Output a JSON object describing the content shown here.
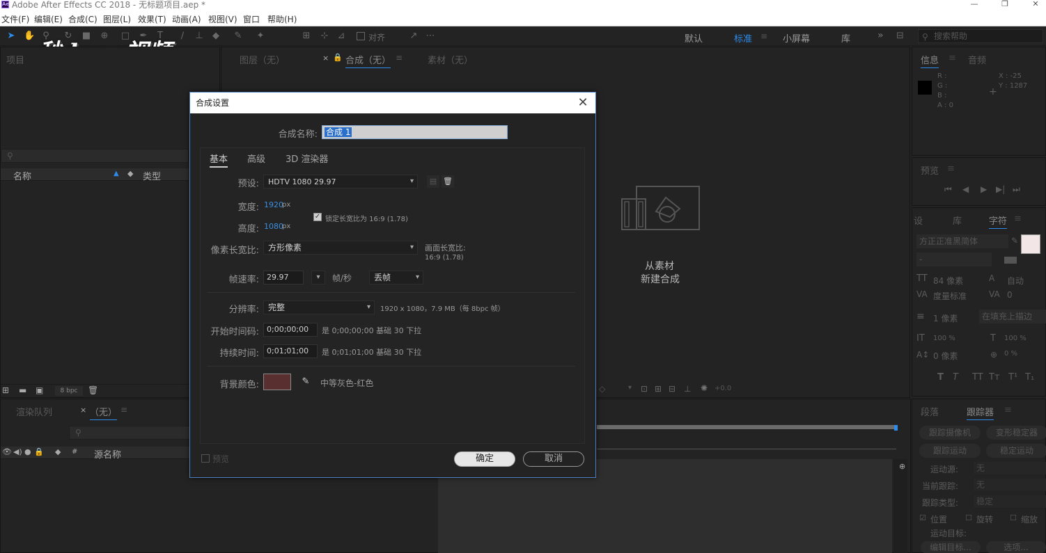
{
  "app": {
    "title": "Adobe After Effects CC 2018 - 无标题项目.aep *",
    "logo": "Ae"
  },
  "menu": [
    "文件(F)",
    "编辑(E)",
    "合成(C)",
    "图层(L)",
    "效果(T)",
    "动画(A)",
    "视图(V)",
    "窗口",
    "帮助(H)"
  ],
  "toolbar": {
    "align_label": "对齐"
  },
  "workspaces": [
    "默认",
    "标准",
    "小屏幕",
    "库"
  ],
  "help_search": {
    "placeholder": "搜索帮助"
  },
  "watermark": "秒dong视频",
  "project_panel": {
    "tab": "项目",
    "columns": {
      "name": "名称",
      "type": "类型"
    },
    "bpc": "8 bpc"
  },
  "viewer_tabs": {
    "layer": "图层（无）",
    "comp": "合成（无）",
    "footage": "素材（无）"
  },
  "viewer_empty": {
    "line1": "从素材",
    "line2": "新建合成"
  },
  "render_panel": {
    "tab1": "渲染队列",
    "tab2": "（无）",
    "source_name": "源名称"
  },
  "info_panel": {
    "tab1": "信息",
    "tab2": "音频",
    "r": "R :",
    "g": "G :",
    "b": "B :",
    "a": "A : 0",
    "x": "X : -25",
    "y": "Y : 1287"
  },
  "preview_panel": {
    "tab": "预览"
  },
  "char_panel": {
    "tabs": [
      "设",
      "库",
      "字符"
    ],
    "font": "方正正准黑简体",
    "style": "-",
    "size": "84 像素",
    "leading": "自动",
    "kerning": "度量标准",
    "tracking": "0",
    "stroke": "1 像素",
    "stroke_mode": "在填充上描边",
    "vscale": "100 %",
    "hscale": "100 %",
    "baseline": "0 像素",
    "tsume": "0 %"
  },
  "tracker_panel": {
    "tabs": [
      "段落",
      "跟踪器"
    ],
    "btn_camera": "跟踪摄像机",
    "btn_warp": "变形稳定器",
    "btn_motion": "跟踪运动",
    "btn_stab": "稳定运动",
    "source_label": "运动源:",
    "source_val": "无",
    "current_label": "当前跟踪:",
    "current_val": "无",
    "type_label": "跟踪类型:",
    "type_val": "稳定",
    "pos": "位置",
    "rot": "旋转",
    "scale": "缩放",
    "target_label": "运动目标:",
    "edit_target": "编辑目标...",
    "options": "选项..."
  },
  "comp_controls": {
    "offset": "+0.0"
  },
  "dialog": {
    "title": "合成设置",
    "name_label": "合成名称:",
    "name_value": "合成 1",
    "tabs": [
      "基本",
      "高级",
      "3D 渲染器"
    ],
    "preset_label": "预设:",
    "preset_value": "HDTV 1080 29.97",
    "width_label": "宽度:",
    "width_value": "1920",
    "width_unit": "px",
    "height_label": "高度:",
    "height_value": "1080",
    "height_unit": "px",
    "lock_aspect": "锁定长宽比为 16:9 (1.78)",
    "par_label": "像素长宽比:",
    "par_value": "方形像素",
    "frame_aspect_label": "画面长宽比:",
    "frame_aspect_value": "16:9 (1.78)",
    "fps_label": "帧速率:",
    "fps_value": "29.97",
    "fps_unit": "帧/秒",
    "drop_frame": "丢帧",
    "res_label": "分辨率:",
    "res_value": "完整",
    "res_info": "1920 x 1080，7.9 MB（每 8bpc 帧）",
    "start_label": "开始时间码:",
    "start_value": "0;00;00;00",
    "start_info": "是 0;00;00;00  基础 30  下拉",
    "dur_label": "持续时间:",
    "dur_value": "0;01;01;00",
    "dur_info": "是 0;01;01;00  基础 30  下拉",
    "bg_label": "背景颜色:",
    "bg_color": "#5a2f2f",
    "bg_name": "中等灰色-红色",
    "preview_label": "预览",
    "ok": "确定",
    "cancel": "取消"
  }
}
